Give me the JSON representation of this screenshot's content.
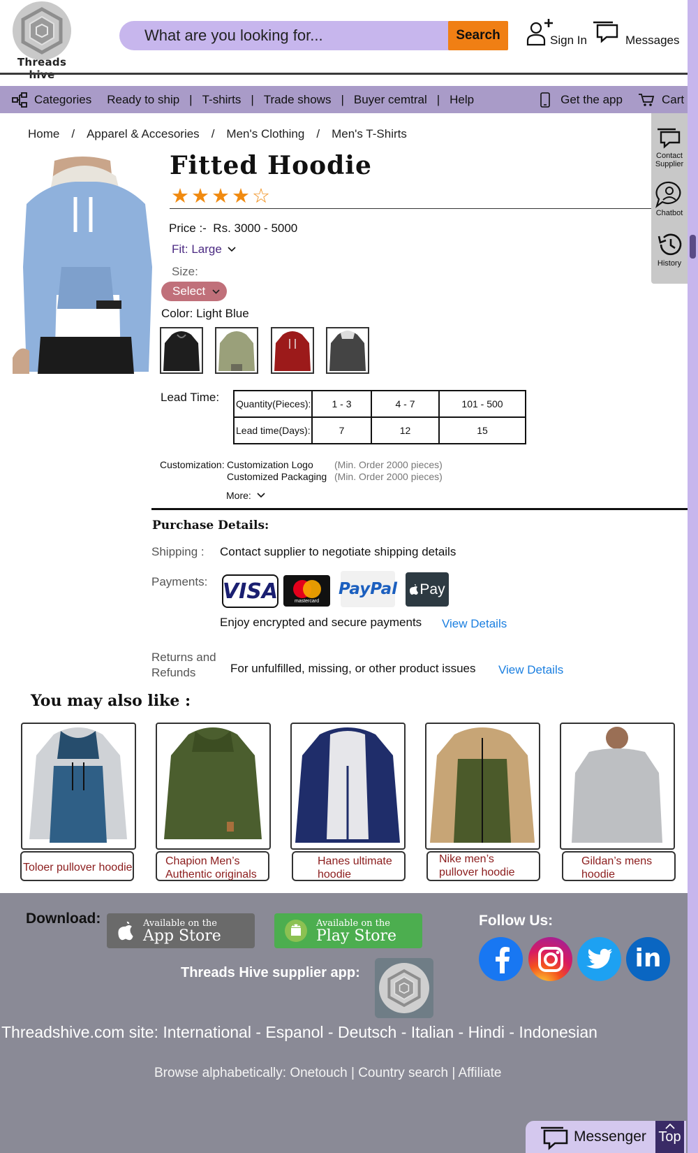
{
  "header": {
    "logo_text": "Threads hive",
    "search_placeholder": "What are you looking for...",
    "search_button": "Search",
    "sign_in": "Sign In",
    "messages": "Messages"
  },
  "nav": {
    "categories": "Categories",
    "items": [
      "Ready to ship",
      "T-shirts",
      "Trade shows",
      "Buyer cemtral",
      "Help"
    ],
    "get_app": "Get the app",
    "cart": "Cart"
  },
  "side_panel": {
    "contact_line1": "Contact",
    "contact_line2": "Supplier",
    "chatbot": "Chatbot",
    "history": "History"
  },
  "breadcrumb": {
    "items": [
      "Home",
      "Apparel & Accesories",
      "Men's Clothing",
      "Men's T-Shirts"
    ],
    "separator": "/"
  },
  "product": {
    "title": "Fitted Hoodie",
    "rating": 4,
    "rating_max": 5,
    "price_label": "Price :-",
    "price_value": "Rs. 3000 - 5000",
    "fit": "Fit: Large",
    "size_label": "Size:",
    "size_select": "Select",
    "color_label": "Color: Light Blue",
    "swatches": [
      "black",
      "olive",
      "red",
      "charcoal"
    ],
    "lead_time_label": "Lead Time:",
    "lead_table": {
      "row1": [
        "Quantity(Pieces):",
        "1 - 3",
        "4 - 7",
        "101 - 500"
      ],
      "row2": [
        "Lead time(Days):",
        "7",
        "12",
        "15"
      ]
    },
    "customization_label": "Customization:",
    "customizations": [
      {
        "name": "Customization Logo",
        "note": "(Min. Order 2000 pieces)"
      },
      {
        "name": "Customized Packaging",
        "note": "(Min. Order 2000 pieces)"
      }
    ],
    "more": "More:"
  },
  "purchase": {
    "heading": "Purchase Details:",
    "shipping_label": "Shipping :",
    "shipping_text": "Contact supplier to negotiate shipping details",
    "payments_label": "Payments:",
    "payment_logos": {
      "visa": "VISA",
      "mastercard": "mastercard",
      "paypal": "PayPal",
      "applepay": "Pay"
    },
    "secure_text": "Enjoy encrypted and secure payments",
    "view_details": "View Details",
    "returns_line1": "Returns and",
    "returns_line2": "Refunds",
    "returns_text": "For unfulfilled, missing, or other product issues"
  },
  "also_like": {
    "heading": "You may also like :",
    "items": [
      {
        "line1": "Toloer pullover hoodie",
        "line2": ""
      },
      {
        "line1": "Chapion Men’s",
        "line2": "Authentic originals"
      },
      {
        "line1": "Hanes ultimate",
        "line2": "hoodie"
      },
      {
        "line1": "Nike men’s",
        "line2": "pullover hoodie"
      },
      {
        "line1": "Gildan’s mens",
        "line2": "hoodie"
      }
    ]
  },
  "footer": {
    "download": "Download:",
    "appstore_small": "Available on the",
    "appstore_big": "App Store",
    "playstore_small": "Available on the",
    "playstore_big": "Play Store",
    "follow": "Follow Us:",
    "supplier_app": "Threads Hive supplier app:",
    "sites": "Threadshive.com site: International - Espanol - Deutsch - Italian - Hindi - Indonesian",
    "browse": "Browse alphabetically: Onetouch | Country search | Affiliate",
    "messenger": "Messenger",
    "top": "Top"
  },
  "colors": {
    "accent": "#c7b6ed",
    "nav_bg": "#a99bc8",
    "search_button": "#f07f14",
    "star": "#f08a10",
    "footer_bg": "#8a8a96",
    "link": "#1b7fe0"
  }
}
